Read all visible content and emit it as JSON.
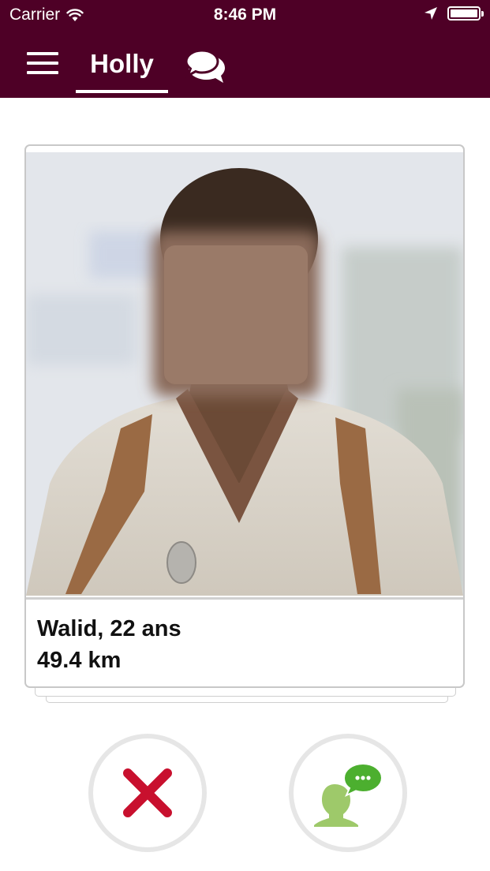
{
  "status_bar": {
    "carrier": "Carrier",
    "time": "8:46 PM",
    "icons": [
      "wifi-icon",
      "location-arrow-icon",
      "battery-icon"
    ]
  },
  "header": {
    "menu_icon": "hamburger-menu-icon",
    "active_tab": "Holly",
    "chat_icon": "chat-bubbles-icon",
    "background_color": "#4e0026"
  },
  "profile": {
    "name_age": "Walid, 22 ans",
    "distance": "49.4 km"
  },
  "actions": {
    "reject_icon": "close-x-icon",
    "reject_color": "#c8102e",
    "message_icon": "start-conversation-icon",
    "message_color": "#7fba42"
  }
}
